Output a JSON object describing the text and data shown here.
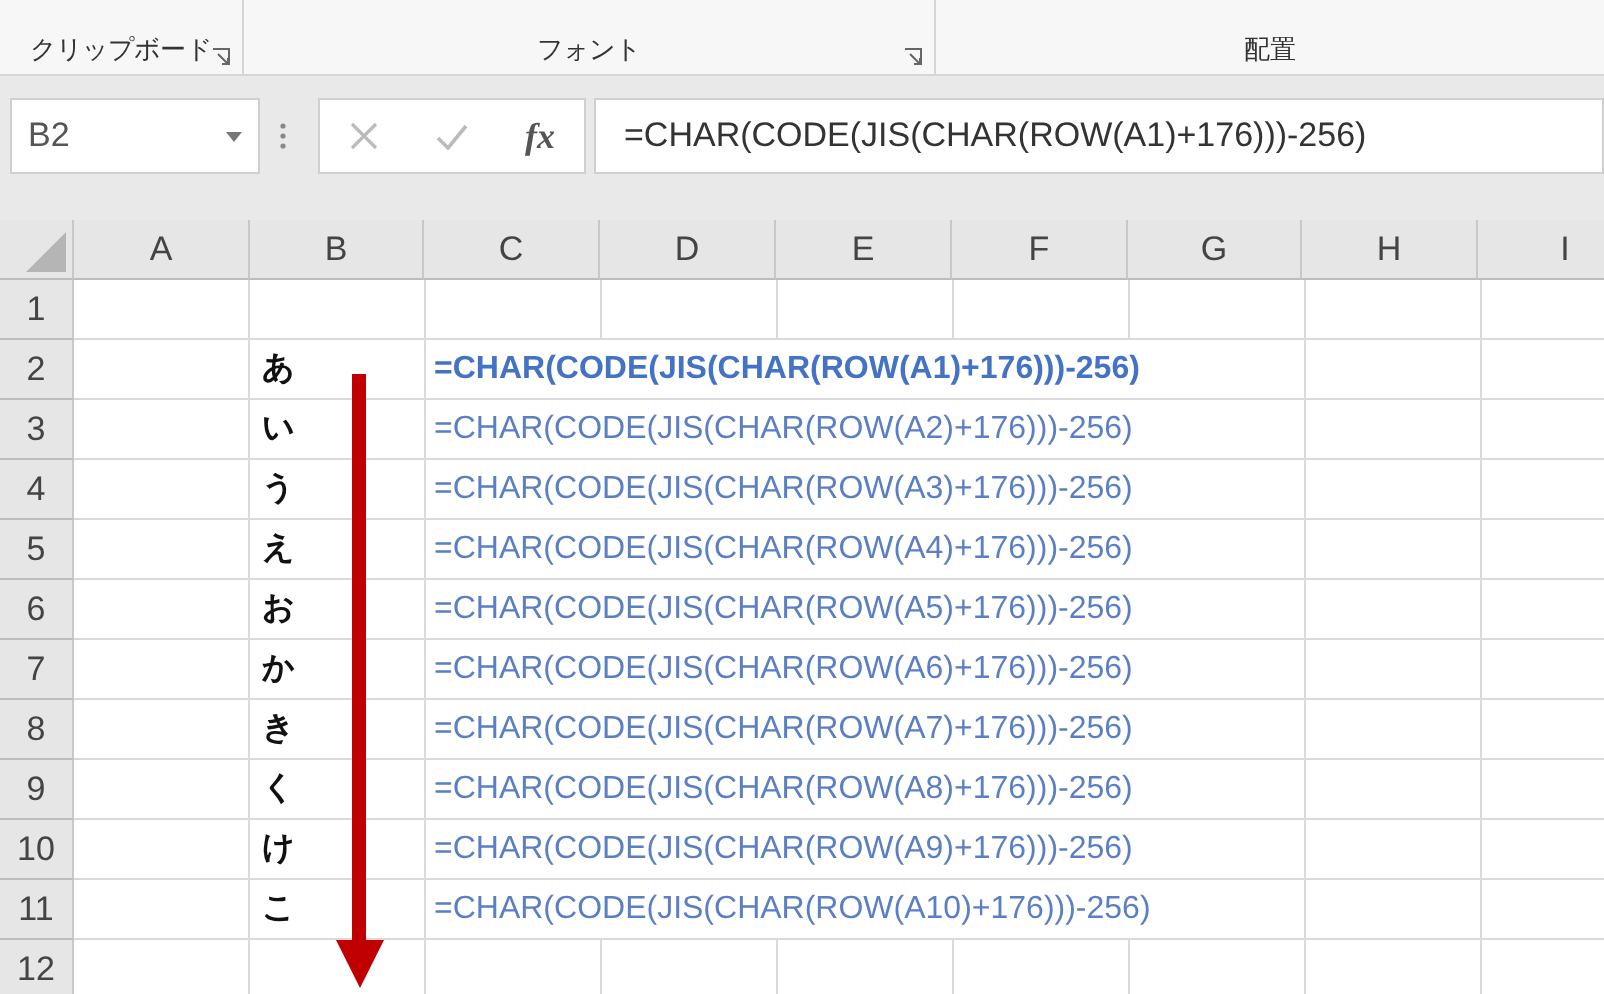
{
  "ribbon": {
    "groups": [
      {
        "label": "クリップボード",
        "launcher": true
      },
      {
        "label": "フォント",
        "launcher": true
      },
      {
        "label": "配置",
        "launcher": false
      }
    ]
  },
  "formula_bar": {
    "name_box": "B2",
    "fx": "fx",
    "formula": "=CHAR(CODE(JIS(CHAR(ROW(A1)+176)))-256)"
  },
  "sheet": {
    "columns": [
      "A",
      "B",
      "C",
      "D",
      "E",
      "F",
      "G",
      "H",
      "I"
    ],
    "rows": [
      {
        "header": "1"
      },
      {
        "header": "2",
        "column_b": "あ",
        "column_c": "=CHAR(CODE(JIS(CHAR(ROW(A1)+176)))-256)",
        "bold": true
      },
      {
        "header": "3",
        "column_b": "い",
        "column_c": "=CHAR(CODE(JIS(CHAR(ROW(A2)+176)))-256)",
        "bold": false
      },
      {
        "header": "4",
        "column_b": "う",
        "column_c": "=CHAR(CODE(JIS(CHAR(ROW(A3)+176)))-256)",
        "bold": false
      },
      {
        "header": "5",
        "column_b": "え",
        "column_c": "=CHAR(CODE(JIS(CHAR(ROW(A4)+176)))-256)",
        "bold": false
      },
      {
        "header": "6",
        "column_b": "お",
        "column_c": "=CHAR(CODE(JIS(CHAR(ROW(A5)+176)))-256)",
        "bold": false
      },
      {
        "header": "7",
        "column_b": "か",
        "column_c": "=CHAR(CODE(JIS(CHAR(ROW(A6)+176)))-256)",
        "bold": false
      },
      {
        "header": "8",
        "column_b": "き",
        "column_c": "=CHAR(CODE(JIS(CHAR(ROW(A7)+176)))-256)",
        "bold": false
      },
      {
        "header": "9",
        "column_b": "く",
        "column_c": "=CHAR(CODE(JIS(CHAR(ROW(A8)+176)))-256)",
        "bold": false
      },
      {
        "header": "10",
        "column_b": "け",
        "column_c": "=CHAR(CODE(JIS(CHAR(ROW(A9)+176)))-256)",
        "bold": false
      },
      {
        "header": "11",
        "column_b": "こ",
        "column_c": "=CHAR(CODE(JIS(CHAR(ROW(A10)+176)))-256)",
        "bold": false
      },
      {
        "header": "12"
      }
    ]
  }
}
